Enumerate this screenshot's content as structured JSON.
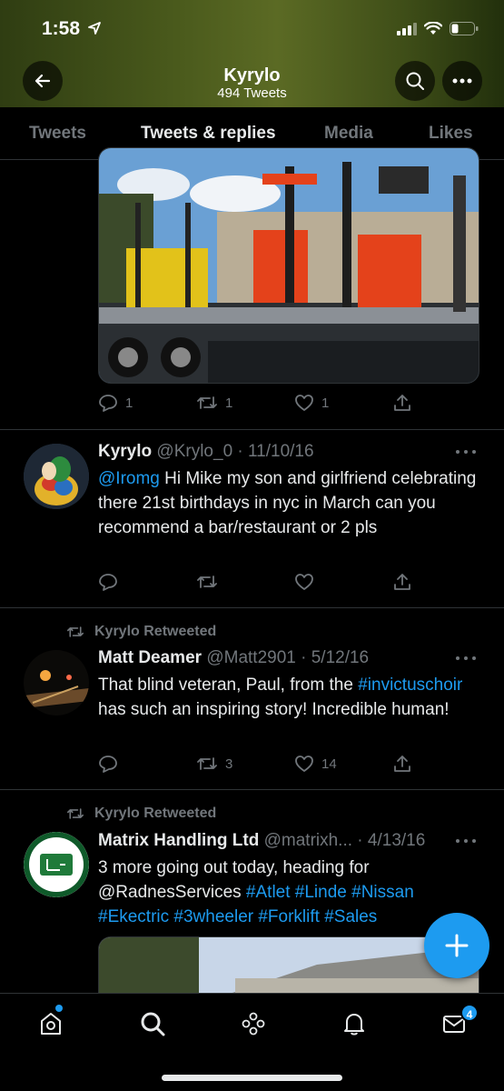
{
  "status_bar": {
    "time": "1:58"
  },
  "header": {
    "title": "Kyrylo",
    "subtitle": "494 Tweets"
  },
  "tabs": [
    {
      "label": "Tweets"
    },
    {
      "label": "Tweets & replies"
    },
    {
      "label": "Media"
    },
    {
      "label": "Likes"
    }
  ],
  "tweet1_media": {
    "description": "forklifts-on-lorry-image",
    "stats": {
      "replies": "1",
      "retweets": "1",
      "likes": "1"
    }
  },
  "tweet2": {
    "name": "Kyrylo",
    "meta": "@Krylo_0 · 11/10/16",
    "mention": "@Iromg",
    "text": " Hi Mike my son and girlfriend celebrating there 21st birthdays in nyc in March can you recommend a bar/restaurant or 2 pls"
  },
  "tweet3": {
    "retweeted_by": "Kyrylo Retweeted",
    "name": "Matt Deamer",
    "meta": "@Matt2901 · 5/12/16",
    "text_before": "That blind veteran, Paul, from the ",
    "hashtag": "#invictuschoir",
    "text_after": " has such an inspiring story! Incredible human!",
    "retweets": "3",
    "likes": "14"
  },
  "tweet4": {
    "retweeted_by": "Kyrylo Retweeted",
    "name": "Matrix Handling Ltd",
    "meta": "@matrixh... · 4/13/16",
    "text_before": "3 more going out today, heading for @RadnesServices ",
    "hashtags": "#Atlet #Linde #Nissan #Ekectric #3wheeler #Forklift #Sales"
  },
  "bottom_nav": {
    "messages_badge": "4"
  },
  "colors": {
    "accent": "#1d9bf0",
    "muted": "#71767b",
    "text": "#e7e9ea",
    "background": "#000000"
  }
}
